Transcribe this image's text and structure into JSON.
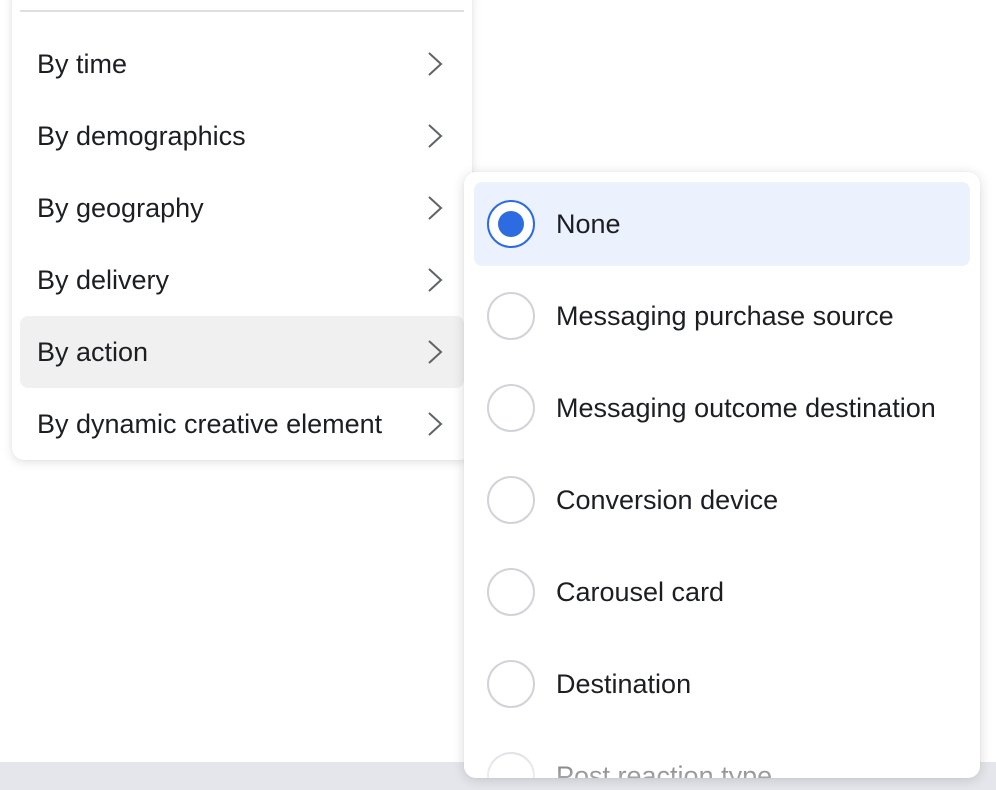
{
  "breakdown_menu": {
    "items": [
      {
        "label": "By time",
        "icon": "chevron-right-icon"
      },
      {
        "label": "By demographics",
        "icon": "chevron-right-icon"
      },
      {
        "label": "By geography",
        "icon": "chevron-right-icon"
      },
      {
        "label": "By delivery",
        "icon": "chevron-right-icon"
      },
      {
        "label": "By action",
        "icon": "chevron-right-icon",
        "selected": true
      },
      {
        "label": "By dynamic creative element",
        "icon": "chevron-right-icon"
      }
    ]
  },
  "action_submenu": {
    "selected_value": "None",
    "options": [
      {
        "label": "None",
        "selected": true
      },
      {
        "label": "Messaging purchase source",
        "selected": false
      },
      {
        "label": "Messaging outcome destination",
        "selected": false
      },
      {
        "label": "Conversion device",
        "selected": false
      },
      {
        "label": "Carousel card",
        "selected": false
      },
      {
        "label": "Destination",
        "selected": false
      },
      {
        "label": "Post reaction type",
        "selected": false
      }
    ]
  },
  "colors": {
    "accent": "#2d6ce0",
    "selected_option_bg": "#ebf1fd",
    "hover_item_bg": "#f0f0f0",
    "text": "#1c1e21"
  }
}
